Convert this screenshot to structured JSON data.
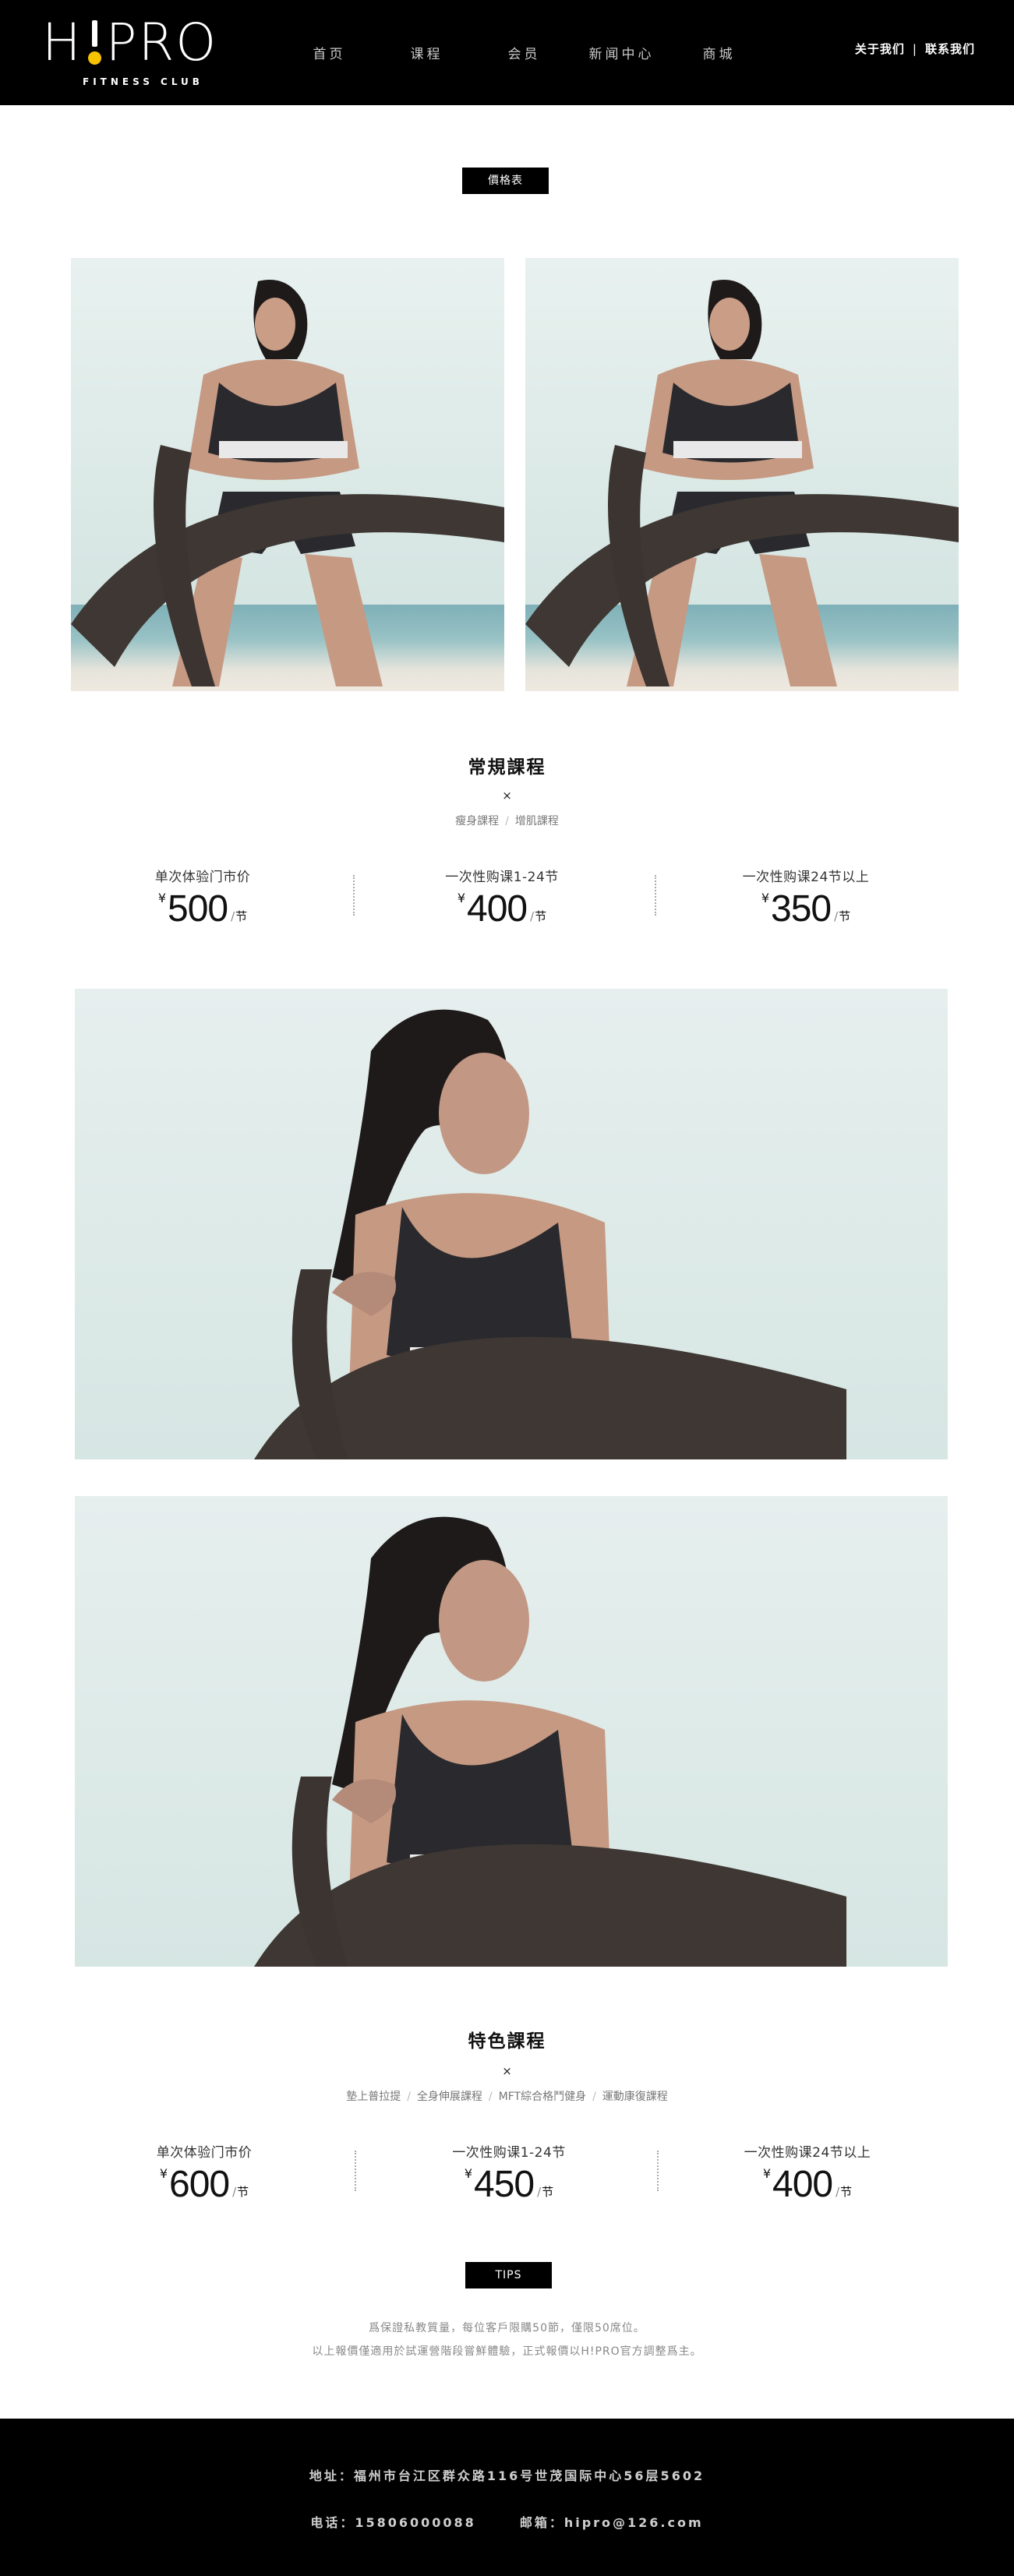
{
  "header": {
    "logo_text_left": "H",
    "logo_text_right": "PRO",
    "logo_sub": "FITNESS CLUB",
    "nav": [
      {
        "label": "首页",
        "name": "nav-home"
      },
      {
        "label": "课程",
        "name": "nav-courses"
      },
      {
        "label": "会员",
        "name": "nav-membership"
      },
      {
        "label": "新闻中心",
        "name": "nav-news"
      },
      {
        "label": "商城",
        "name": "nav-shop"
      }
    ],
    "about_label": "关于我们",
    "separator": "|",
    "contact_label": "联系我们"
  },
  "price_badge": "價格表",
  "regular": {
    "title": "常規課程",
    "x": "×",
    "tags": [
      "瘦身課程",
      "增肌課程"
    ],
    "tag_sep": "/",
    "prices": [
      {
        "label": "单次体验门市价",
        "currency": "¥",
        "value": "500",
        "unit_sep": "/",
        "unit": "节"
      },
      {
        "label": "一次性购课1-24节",
        "currency": "¥",
        "value": "400",
        "unit_sep": "/",
        "unit": "节"
      },
      {
        "label": "一次性购课24节以上",
        "currency": "¥",
        "value": "350",
        "unit_sep": "/",
        "unit": "节"
      }
    ]
  },
  "special": {
    "title": "特色課程",
    "x": "×",
    "tags": [
      "墊上普拉提",
      "全身伸展課程",
      "MFT綜合格鬥健身",
      "運動康復課程"
    ],
    "tag_sep": "/",
    "prices": [
      {
        "label": "单次体验门市价",
        "currency": "¥",
        "value": "600",
        "unit_sep": "/",
        "unit": "节"
      },
      {
        "label": "一次性购课1-24节",
        "currency": "¥",
        "value": "450",
        "unit_sep": "/",
        "unit": "节"
      },
      {
        "label": "一次性购课24节以上",
        "currency": "¥",
        "value": "400",
        "unit_sep": "/",
        "unit": "节"
      }
    ]
  },
  "tips": {
    "badge": "TIPS",
    "line1": "爲保證私教質量，每位客戶限購50節，僅限50席位。",
    "line2": "以上報價僅適用於試運營階段嘗鮮體驗，正式報價以H!PRO官方調整爲主。"
  },
  "footer": {
    "address": "地址：福州市台江区群众路116号世茂国际中心56层5602",
    "phone": "电话：15806000088",
    "email": "邮箱：hipro@126.com"
  },
  "colors": {
    "header_bg": "#000000",
    "accent_yellow": "#f7c300",
    "footer_bg": "#000000"
  }
}
